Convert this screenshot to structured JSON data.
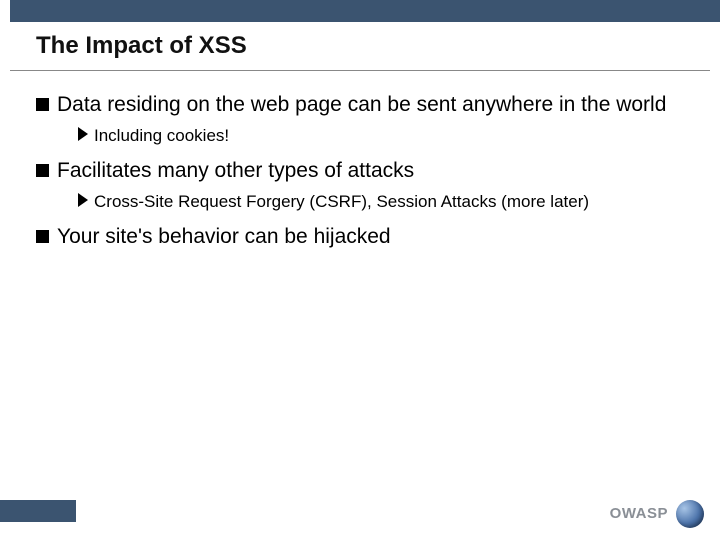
{
  "title": "The Impact of XSS",
  "bullets": {
    "b0": {
      "text": "Data residing on the web page can be sent anywhere in the world",
      "sub": {
        "s0": "Including cookies!"
      }
    },
    "b1": {
      "text": "Facilitates many other types of attacks",
      "sub": {
        "s0": "Cross-Site Request Forgery (CSRF), Session Attacks (more later)"
      }
    },
    "b2": {
      "text": "Your site's behavior can be hijacked"
    }
  },
  "footer": {
    "label": "OWASP"
  }
}
